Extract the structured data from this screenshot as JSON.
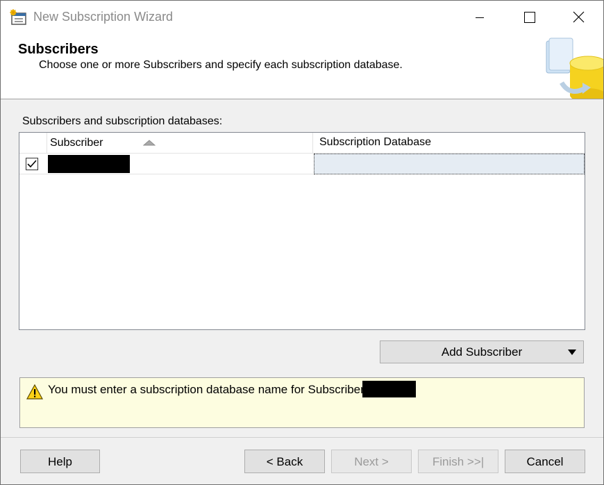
{
  "window": {
    "title": "New Subscription Wizard",
    "icons": {
      "app": "wizard-app-icon",
      "minimize": "minimize-icon",
      "maximize": "maximize-icon",
      "close": "close-icon"
    }
  },
  "header": {
    "title": "Subscribers",
    "subtitle": "Choose one or more Subscribers and specify each subscription database.",
    "graphic": "database-sync-graphic"
  },
  "subscribers": {
    "label": "Subscribers and subscription databases:",
    "columns": [
      "Subscriber",
      "Subscription Database"
    ],
    "sort": {
      "column": "Subscriber",
      "direction": "ascending",
      "icon": "sort-ascending-icon"
    },
    "rows": [
      {
        "checked": true,
        "subscriber": "[redacted]",
        "subscription_database": ""
      }
    ]
  },
  "add_subscriber_button": {
    "label": "Add Subscriber",
    "icon": "dropdown-arrow-icon"
  },
  "warning": {
    "icon": "warning-icon",
    "text": "You must enter a subscription database name for Subscriber '"
  },
  "footer": {
    "help": "Help",
    "back": "< Back",
    "next": "Next >",
    "finish": "Finish >>|",
    "cancel": "Cancel"
  },
  "colors": {
    "selected_cell": "#e5ecf3",
    "warning_background": "#fdfde0",
    "button_face": "#e1e1e1",
    "disabled_text": "#9a9a9a"
  }
}
